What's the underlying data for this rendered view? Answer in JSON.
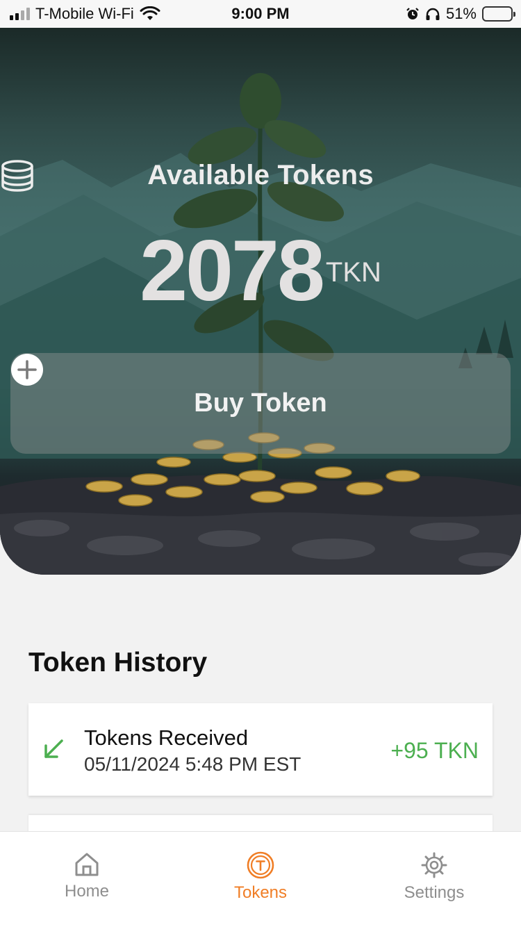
{
  "status_bar": {
    "carrier": "T-Mobile Wi-Fi",
    "time": "9:00 PM",
    "battery": "51%"
  },
  "hero": {
    "label": "Available Tokens",
    "balance": "2078",
    "unit": "TKN",
    "buy_button_label": "Buy Token"
  },
  "history": {
    "title": "Token History",
    "items": [
      {
        "title": "Tokens Received",
        "date": "05/11/2024  5:48 PM EST",
        "amount": "+95 TKN",
        "icon": "arrow-down-left-icon"
      }
    ]
  },
  "tab_bar": {
    "items": [
      {
        "label": "Home",
        "icon": "home-icon",
        "active": false
      },
      {
        "label": "Tokens",
        "icon": "token-icon",
        "active": true
      },
      {
        "label": "Settings",
        "icon": "gear-icon",
        "active": false
      }
    ]
  },
  "colors": {
    "accent": "#f07e26",
    "positive": "#4caf50",
    "inactive": "#8e8e8e"
  }
}
